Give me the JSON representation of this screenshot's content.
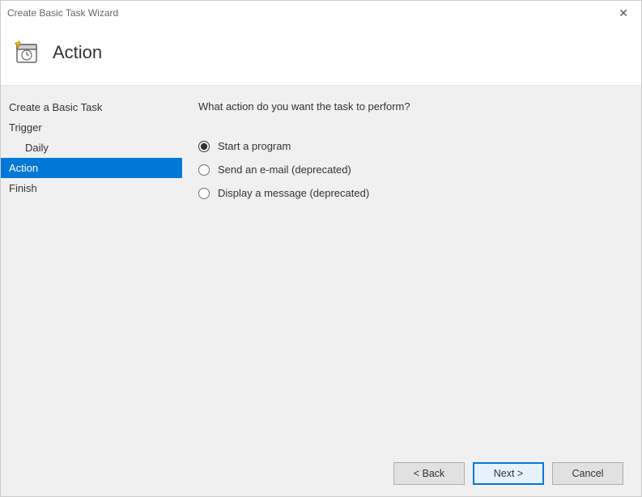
{
  "window": {
    "title": "Create Basic Task Wizard"
  },
  "header": {
    "title": "Action"
  },
  "sidebar": {
    "items": [
      {
        "label": "Create a Basic Task",
        "selected": false,
        "indent": false
      },
      {
        "label": "Trigger",
        "selected": false,
        "indent": false
      },
      {
        "label": "Daily",
        "selected": false,
        "indent": true
      },
      {
        "label": "Action",
        "selected": true,
        "indent": false
      },
      {
        "label": "Finish",
        "selected": false,
        "indent": false
      }
    ]
  },
  "content": {
    "prompt": "What action do you want the task to perform?",
    "options": [
      {
        "label": "Start a program",
        "checked": true
      },
      {
        "label": "Send an e-mail (deprecated)",
        "checked": false
      },
      {
        "label": "Display a message (deprecated)",
        "checked": false
      }
    ]
  },
  "footer": {
    "back_label": "< Back",
    "next_label": "Next >",
    "cancel_label": "Cancel"
  }
}
